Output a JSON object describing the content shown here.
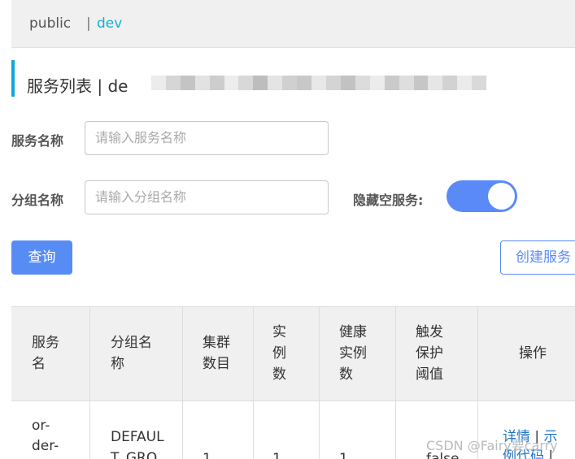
{
  "namespace_bar": {
    "items": [
      "public",
      "dev"
    ],
    "separator": "|"
  },
  "page": {
    "title": "服务列表  |  de",
    "accent_color": "#12a6d8"
  },
  "filters": {
    "service_name_label": "服务名称",
    "service_name_placeholder": "请输入服务名称",
    "group_name_label": "分组名称",
    "group_name_placeholder": "请输入分组名称",
    "hide_empty_label": "隐藏空服务:",
    "hide_empty_enabled": true
  },
  "buttons": {
    "query": "查询",
    "create": "创建服务"
  },
  "table": {
    "headers": [
      [
        "服务",
        "名"
      ],
      [
        "分组名",
        "称"
      ],
      [
        "集群",
        "数目"
      ],
      [
        "实",
        "例",
        "数"
      ],
      [
        "健康",
        "实例",
        "数"
      ],
      [
        "触发",
        "保护",
        "阈值"
      ],
      [
        "操作"
      ]
    ],
    "row": {
      "service": [
        "or-",
        "der-"
      ],
      "group": [
        "DEFAUL",
        "T_GRO"
      ],
      "clusters": "1",
      "instances": "1",
      "healthy": "1",
      "threshold": "false",
      "actions": [
        "详情",
        "|",
        "示",
        "例代码",
        "|"
      ]
    }
  },
  "watermark": "CSDN @Fairy要carry"
}
